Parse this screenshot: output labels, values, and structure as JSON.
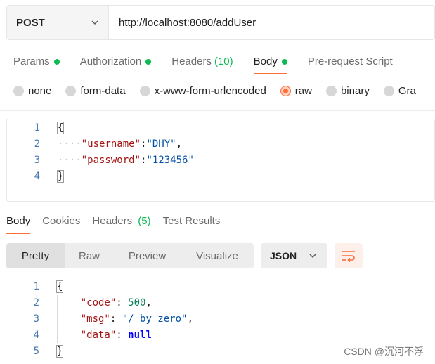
{
  "request": {
    "method": "POST",
    "url": "http://localhost:8080/addUser"
  },
  "request_tabs": [
    {
      "label": "Params",
      "dot": true
    },
    {
      "label": "Authorization",
      "dot": true
    },
    {
      "label": "Headers",
      "count": "(10)"
    },
    {
      "label": "Body",
      "dot": true,
      "active": true
    },
    {
      "label": "Pre-request Script"
    }
  ],
  "body_types": [
    {
      "label": "none"
    },
    {
      "label": "form-data"
    },
    {
      "label": "x-www-form-urlencoded"
    },
    {
      "label": "raw",
      "selected": true
    },
    {
      "label": "binary"
    },
    {
      "label": "Gra"
    }
  ],
  "request_body": {
    "line_numbers": [
      "1",
      "2",
      "3",
      "4"
    ],
    "open_brace": "{",
    "close_brace": "}",
    "indent": "····",
    "fields": [
      {
        "key": "\"username\"",
        "sep": ":",
        "value": "\"DHY\"",
        "trail": ","
      },
      {
        "key": "\"password\"",
        "sep": ":",
        "value": "\"123456\"",
        "trail": ""
      }
    ]
  },
  "response_tabs": [
    {
      "label": "Body",
      "active": true
    },
    {
      "label": "Cookies"
    },
    {
      "label": "Headers",
      "count": "(5)"
    },
    {
      "label": "Test Results"
    }
  ],
  "view_modes": [
    {
      "label": "Pretty",
      "active": true
    },
    {
      "label": "Raw"
    },
    {
      "label": "Preview"
    },
    {
      "label": "Visualize"
    }
  ],
  "format_select": "JSON",
  "response_body": {
    "line_numbers": [
      "1",
      "2",
      "3",
      "4",
      "5"
    ],
    "open_brace": "{",
    "close_brace": "}",
    "fields": [
      {
        "key": "\"code\"",
        "sep": ": ",
        "value": "500",
        "type": "number",
        "trail": ","
      },
      {
        "key": "\"msg\"",
        "sep": ": ",
        "value": "\"/ by zero\"",
        "type": "string",
        "trail": ","
      },
      {
        "key": "\"data\"",
        "sep": ": ",
        "value": "null",
        "type": "keyword",
        "trail": ""
      }
    ]
  },
  "watermark": "CSDN @沉河不浮",
  "colors": {
    "accent": "#ff6c37",
    "status_dot": "#0cbb52"
  },
  "icons": {
    "method_dropdown": "chevron-down-icon",
    "format_dropdown": "chevron-down-icon",
    "wrap": "wrap-lines-icon"
  }
}
